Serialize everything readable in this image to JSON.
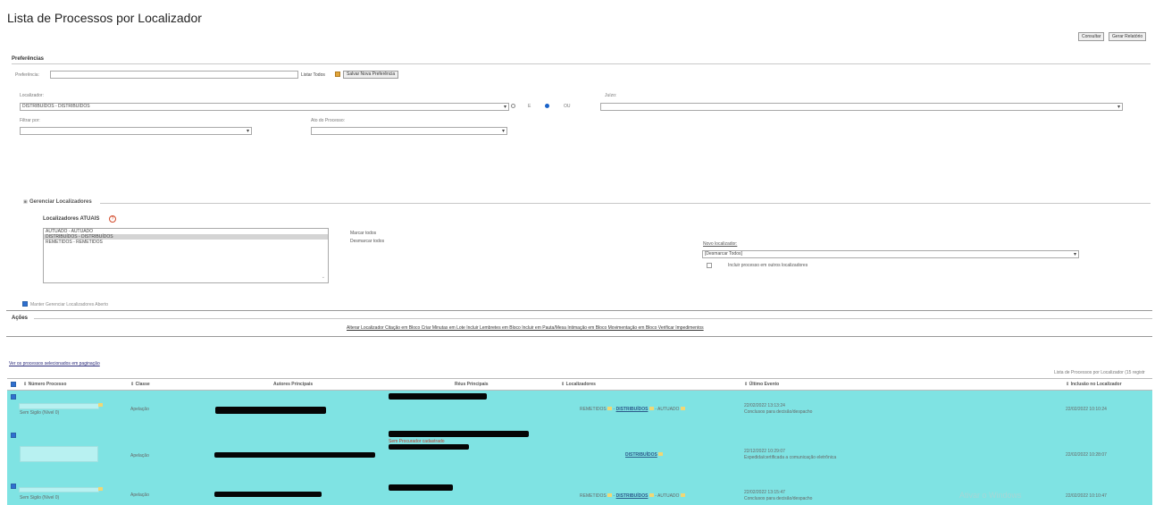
{
  "page": {
    "title": "Lista de Processos por Localizador"
  },
  "toolbar": {
    "consultar": "Consultar",
    "gerar_relatorio": "Gerar Relatório"
  },
  "preferencias": {
    "section_title": "Preferências",
    "label": "Preferência:",
    "listar_todos": "Listar Todos",
    "salvar_nova": "Salvar Nova Preferência"
  },
  "filtros": {
    "localizador_label": "Localizador:",
    "localizador_value": "DISTRIBUÍDOS - DISTRIBUÍDOS",
    "e_label": "E",
    "ou_label": "OU",
    "juizo_label": "Juízo:",
    "juizo_value": "",
    "filtrar_por_label": "Filtrar por:",
    "filtrar_por_value": "",
    "ato_label": "Ato do Processo:",
    "ato_value": ""
  },
  "gerenciar": {
    "section_title": "Gerenciar Localizadores",
    "atuais_title": "Localizadores ATUAIS",
    "atuais": [
      {
        "label": "AUTUADO - AUTUADO",
        "selected": false
      },
      {
        "label": "DISTRIBUÍDOS - DISTRIBUÍDOS",
        "selected": true
      },
      {
        "label": "REMETIDOS - REMETIDOS",
        "selected": false
      }
    ],
    "marcar_todos": "Marcar todos",
    "desmarcar_todos": "Desmarcar todos",
    "novo_label": "Novo localizador:",
    "novo_value": "[Desmarcar Todos]",
    "incluir_label": "Incluir processo em outros localizadores",
    "manter_label": "Manter Gerenciar Localizadores Aberto"
  },
  "acoes": {
    "section_title": "Ações",
    "links": "Alterar Localizador Citação em Bloco Criar Minutas em Lote Incluir Lembretes em Bloco Incluir em Pauta/Mesa Intimação em Bloco Movimentação em Bloco Verificar Impedimentos"
  },
  "lista": {
    "ver_selecionados": "Ver os processos selecionados em paginação",
    "registros": "Lista de Processos por Localizador (15 registr",
    "columns": [
      "Número Processo",
      "Classe",
      "Autores Principais",
      "Réus Principais",
      "Localizadores",
      "Último Evento",
      "Inclusão no Localizador"
    ],
    "rows": [
      {
        "sigilo": "Sem Sigilo (Nível 0)",
        "classe": "Apelação",
        "loc_pre": "REMETIDOS",
        "loc_main": "DISTRIBUÍDOS",
        "loc_post": "AUTUADO",
        "evento_data": "22/02/2022 13:13:24",
        "evento_desc": "Conclusos para decisão/despacho",
        "inclusao": "22/02/2022 10:10:24",
        "reu_extra": ""
      },
      {
        "sigilo": "",
        "classe": "Apelação",
        "loc_pre": "",
        "loc_main": "DISTRIBUÍDOS",
        "loc_post": "",
        "evento_data": "22/12/2022 10:29:07",
        "evento_desc": "Expedida/certificada a comunicação eletrônica",
        "inclusao": "22/02/2022 10:28:07",
        "reu_extra": "Sem Procurador cadastrado"
      },
      {
        "sigilo": "Sem Sigilo (Nível 0)",
        "classe": "Apelação",
        "loc_pre": "REMETIDOS",
        "loc_main": "DISTRIBUÍDOS",
        "loc_post": "AUTUADO",
        "evento_data": "22/02/2022 13:15:47",
        "evento_desc": "Conclusos para decisão/despacho",
        "inclusao": "22/02/2022 10:10:47",
        "reu_extra": ""
      }
    ]
  },
  "watermark": "Ativar o Windows"
}
